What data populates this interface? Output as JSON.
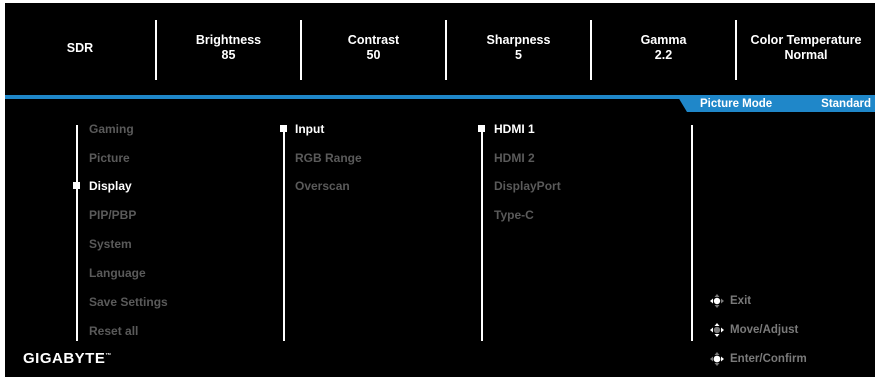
{
  "status_bar": {
    "mode": "SDR",
    "items": [
      {
        "label": "Brightness",
        "value": "85"
      },
      {
        "label": "Contrast",
        "value": "50"
      },
      {
        "label": "Sharpness",
        "value": "5"
      },
      {
        "label": "Gamma",
        "value": "2.2"
      },
      {
        "label": "Color Temperature",
        "value": "Normal"
      }
    ]
  },
  "picture_mode": {
    "label": "Picture Mode",
    "value": "Standard"
  },
  "menu": {
    "items": [
      "Gaming",
      "Picture",
      "Display",
      "PIP/PBP",
      "System",
      "Language",
      "Save Settings",
      "Reset all"
    ],
    "active": "Display"
  },
  "submenu": {
    "items": [
      "Input",
      "RGB Range",
      "Overscan"
    ],
    "active": "Input"
  },
  "options": {
    "items": [
      "HDMI 1",
      "HDMI 2",
      "DisplayPort",
      "Type-C"
    ],
    "active": "HDMI 1"
  },
  "brand": {
    "logo": "GIGABYTE",
    "trademark": "™"
  },
  "hints": [
    {
      "icon": "joystick-left-icon",
      "label": "Exit"
    },
    {
      "icon": "joystick-updown-icon",
      "label": "Move/Adjust"
    },
    {
      "icon": "joystick-press-icon",
      "label": "Enter/Confirm"
    }
  ],
  "colors": {
    "accent": "#1f87c9",
    "background": "#000000",
    "text_active": "#ffffff",
    "text_inactive": "#5a5a5a"
  }
}
